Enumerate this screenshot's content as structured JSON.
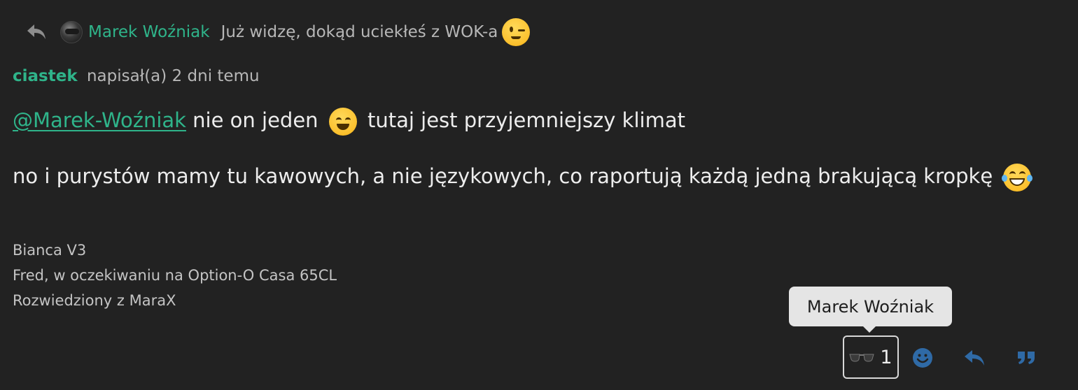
{
  "reply_to": {
    "icon": "reply-icon",
    "author": "Marek Woźniak",
    "text": "Już widzę, dokąd uciekłeś z WOK-a",
    "emoji": "winking-face"
  },
  "post": {
    "author": "ciastek",
    "action": "napisał(a)",
    "time": "2 dni temu",
    "mention": "@Marek-Woźniak",
    "line1_a": "nie on jeden",
    "line1_emoji": "smiling-face-with-smiling-eyes",
    "line1_b": "tutaj jest przyjemniejszy klimat",
    "line2": "no i purystów mamy tu kawowych, a nie językowych, co raportują każdą jedną brakującą kropkę",
    "line2_emoji": "grinning-face-with-tears"
  },
  "signature": [
    "Bianca V3",
    "Fred, w oczekiwaniu na Option-O Casa 65CL",
    "Rozwiedziony z MaraX"
  ],
  "reaction": {
    "icon": "sunglasses-icon",
    "count": "1",
    "tooltip": "Marek Woźniak"
  },
  "actions": [
    {
      "icon": "emoji-react-icon"
    },
    {
      "icon": "reply-icon"
    },
    {
      "icon": "quote-icon"
    }
  ],
  "colors": {
    "background": "#222222",
    "accent": "#2fb48a",
    "action_icon": "#2f6aa6"
  }
}
